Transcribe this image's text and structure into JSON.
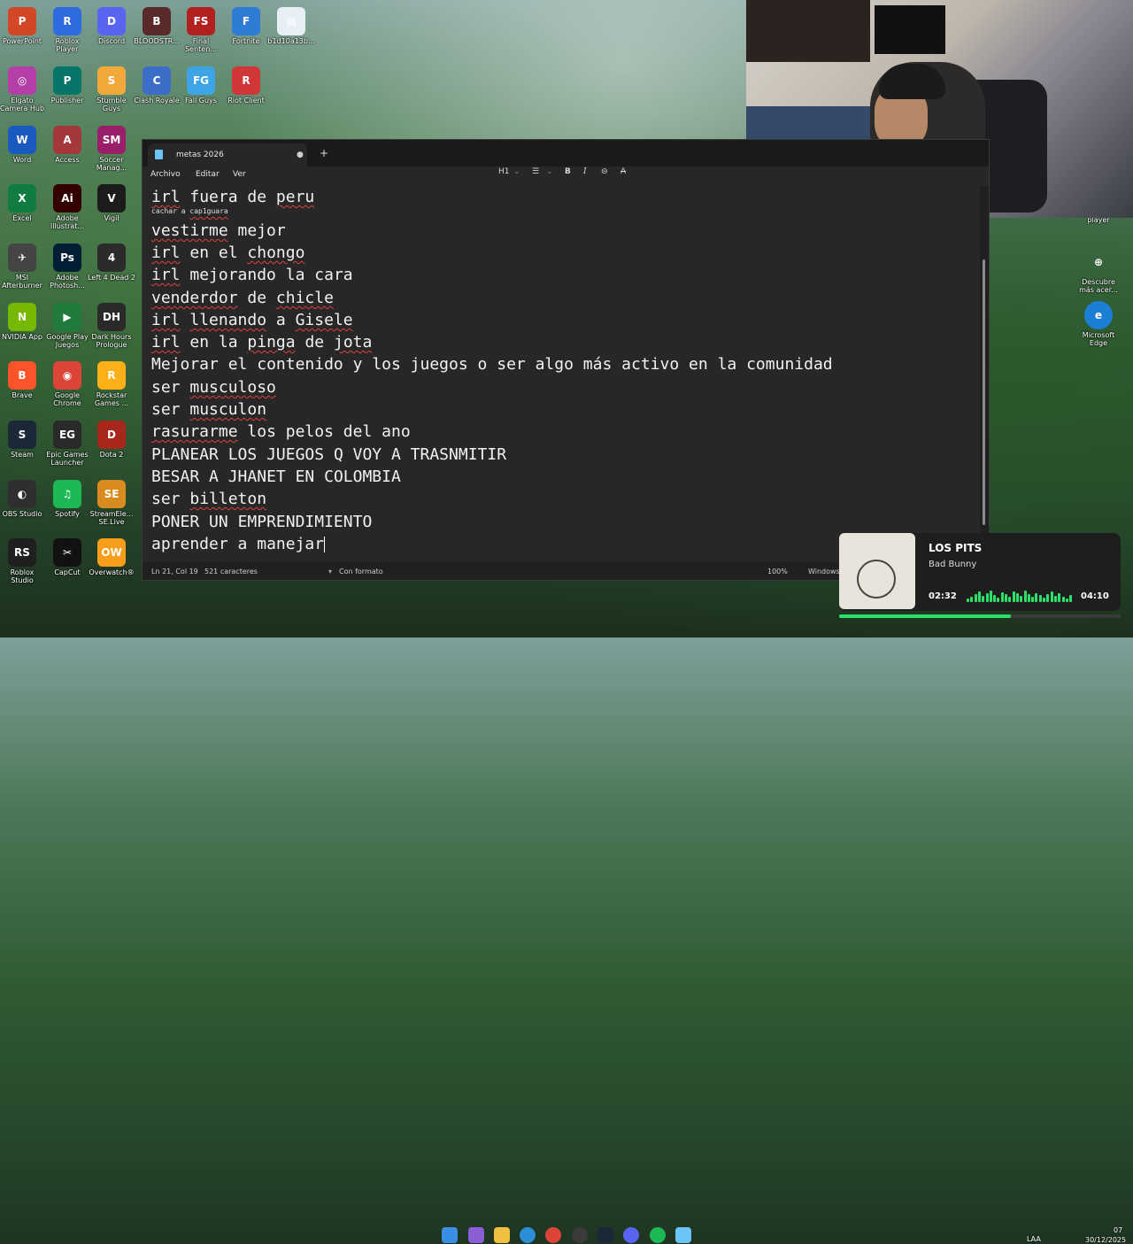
{
  "desktop_icons": [
    {
      "label": "PowerPoint",
      "glyph": "P",
      "color": "#d24726"
    },
    {
      "label": "Roblox Player",
      "glyph": "R",
      "color": "#2d6cdf"
    },
    {
      "label": "Discord",
      "glyph": "D",
      "color": "#5865f2"
    },
    {
      "label": "BLOODSTR...",
      "glyph": "B",
      "color": "#5a2a2a"
    },
    {
      "label": "Final Senten...",
      "glyph": "FS",
      "color": "#b32020"
    },
    {
      "label": "Fortnite",
      "glyph": "F",
      "color": "#2e7cd6"
    },
    {
      "label": "b1d10a13b...",
      "glyph": "▤",
      "color": "#e8eef5"
    },
    {
      "label": "Elgato Camera Hub",
      "glyph": "◎",
      "color": "#b43fa8"
    },
    {
      "label": "Publisher",
      "glyph": "P",
      "color": "#077568"
    },
    {
      "label": "Stumble Guys",
      "glyph": "S",
      "color": "#f2a93b"
    },
    {
      "label": "Clash Royale",
      "glyph": "C",
      "color": "#3c6ec7"
    },
    {
      "label": "Fall Guys",
      "glyph": "FG",
      "color": "#3da5e5"
    },
    {
      "label": "Riot Client",
      "glyph": "R",
      "color": "#d13639"
    },
    {
      "label": "Word",
      "glyph": "W",
      "color": "#185abd"
    },
    {
      "label": "Access",
      "glyph": "A",
      "color": "#a4373a"
    },
    {
      "label": "Soccer Manag...",
      "glyph": "SM",
      "color": "#9a1f6a"
    },
    {
      "label": "Excel",
      "glyph": "X",
      "color": "#107c41"
    },
    {
      "label": "Adobe Illustrat...",
      "glyph": "Ai",
      "color": "#330000"
    },
    {
      "label": "Vigil",
      "glyph": "V",
      "color": "#1c1c1c"
    },
    {
      "label": "MSI Afterburner",
      "glyph": "✈",
      "color": "#444"
    },
    {
      "label": "Adobe Photosh...",
      "glyph": "Ps",
      "color": "#001e36"
    },
    {
      "label": "Left 4 Dead 2",
      "glyph": "4",
      "color": "#2b2b2b"
    },
    {
      "label": "NVIDIA App",
      "glyph": "N",
      "color": "#76b900"
    },
    {
      "label": "Google Play Juegos",
      "glyph": "▶",
      "color": "#1f7a3c"
    },
    {
      "label": "Dark Hours Prologue",
      "glyph": "DH",
      "color": "#2a2a2a"
    },
    {
      "label": "Brave",
      "glyph": "B",
      "color": "#fb542b"
    },
    {
      "label": "Google Chrome",
      "glyph": "◉",
      "color": "#db4437"
    },
    {
      "label": "Rockstar Games ...",
      "glyph": "R",
      "color": "#fcaf17"
    },
    {
      "label": "Steam",
      "glyph": "S",
      "color": "#1b2838"
    },
    {
      "label": "Epic Games Launcher",
      "glyph": "EG",
      "color": "#2a2a2a"
    },
    {
      "label": "Dota 2",
      "glyph": "D",
      "color": "#a8261c"
    },
    {
      "label": "OBS Studio",
      "glyph": "◐",
      "color": "#302e31"
    },
    {
      "label": "Spotify",
      "glyph": "♫",
      "color": "#1db954"
    },
    {
      "label": "StreamEle... SE.Live",
      "glyph": "SE",
      "color": "#d98b1f"
    },
    {
      "label": "Roblox Studio",
      "glyph": "RS",
      "color": "#1f1f1f"
    },
    {
      "label": "CapCut",
      "glyph": "✂",
      "color": "#111"
    },
    {
      "label": "Overwatch®",
      "glyph": "OW",
      "color": "#f99e1a"
    }
  ],
  "right_icons": [
    {
      "label": "player"
    },
    {
      "label": "Descubre más acer..."
    },
    {
      "label": "Microsoft Edge"
    }
  ],
  "notepad": {
    "tab_title": "metas 2026",
    "tab_dot": "●",
    "new_tab": "+",
    "menu": [
      "Archivo",
      "Editar",
      "Ver"
    ],
    "toolbar": {
      "heading": "H1",
      "list": "☰",
      "bold": "B",
      "italic": "I",
      "link": "⊖",
      "clear": "A"
    },
    "lines": [
      {
        "text": "irl fuera de peru",
        "size": "big"
      },
      {
        "text": "cachar a cap1guara",
        "size": "small"
      },
      {
        "text": "vestirme mejor",
        "size": "big"
      },
      {
        "text": "irl en el chongo",
        "size": "big"
      },
      {
        "text": "irl mejorando la cara",
        "size": "big"
      },
      {
        "text": "venderdor de chicle",
        "size": "big"
      },
      {
        "text": "irl llenando a Gisele",
        "size": "big"
      },
      {
        "text": "irl en la pinga de jota",
        "size": "big"
      },
      {
        "text": "Mejorar el contenido y los juegos o ser algo más activo en la comunidad",
        "size": "big"
      },
      {
        "text": "ser musculoso",
        "size": "big"
      },
      {
        "text": "ser musculon",
        "size": "big"
      },
      {
        "text": "rasurarme los pelos del ano",
        "size": "big"
      },
      {
        "text": "PLANEAR LOS JUEGOS Q VOY A TRASNMITIR",
        "size": "big"
      },
      {
        "text": "BESAR A JHANET EN COLOMBIA",
        "size": "big"
      },
      {
        "text": "ser billeton",
        "size": "big"
      },
      {
        "text": "PONER UN EMPRENDIMIENTO",
        "size": "big"
      },
      {
        "text": "aprender a manejar",
        "size": "big"
      }
    ],
    "status": {
      "position": "Ln 21, Col 19",
      "chars": "521 caracteres",
      "format": "Con formato",
      "zoom": "100%",
      "eol": "Windows"
    }
  },
  "music": {
    "title": "LOS PITS",
    "artist": "Bad Bunny",
    "elapsed": "02:32",
    "total": "04:10",
    "progress_fraction": 0.61
  },
  "tray": {
    "lang": "LAA",
    "time": "07",
    "date": "30/12/2025"
  },
  "colors": {
    "accent_green": "#2ee06a",
    "editor_bg": "#272727",
    "spell_error": "#e04040"
  }
}
